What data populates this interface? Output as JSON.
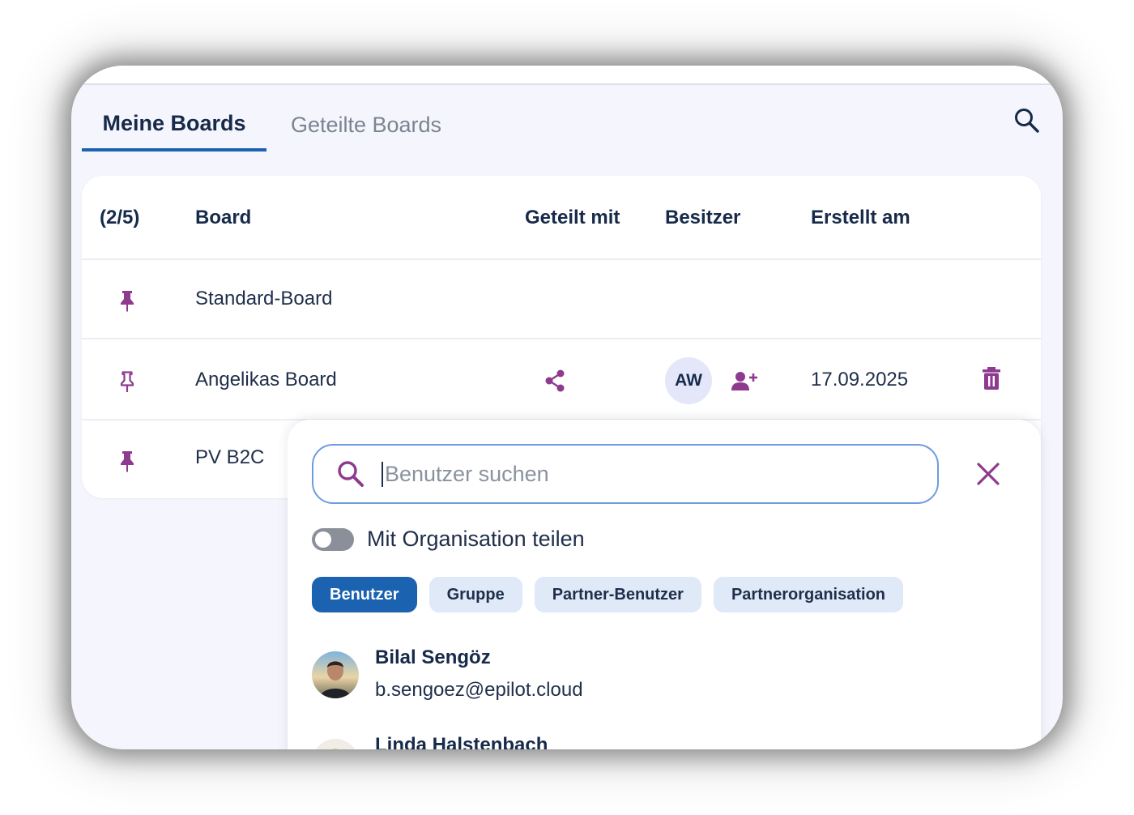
{
  "tabs": [
    {
      "label": "Meine Boards",
      "active": true
    },
    {
      "label": "Geteilte Boards",
      "active": false
    }
  ],
  "table": {
    "header": {
      "count": "(2/5)",
      "board": "Board",
      "shared_with": "Geteilt mit",
      "owner": "Besitzer",
      "created": "Erstellt am"
    },
    "rows": [
      {
        "pinned": true,
        "name": "Standard-Board"
      },
      {
        "pinned": false,
        "name": "Angelikas Board",
        "owner_initials": "AW",
        "created": "17.09.2025"
      },
      {
        "pinned": true,
        "name": "PV B2C"
      }
    ]
  },
  "share_popover": {
    "search_placeholder": "Benutzer suchen",
    "toggle_label": "Mit Organisation teilen",
    "toggle_on": false,
    "filters": [
      {
        "label": "Benutzer",
        "active": true
      },
      {
        "label": "Gruppe",
        "active": false
      },
      {
        "label": "Partner-Benutzer",
        "active": false
      },
      {
        "label": "Partnerorganisation",
        "active": false
      }
    ],
    "users": [
      {
        "name": "Bilal Sengöz",
        "email": "b.sengoez@epilot.cloud"
      },
      {
        "name": "Linda Halstenbach",
        "email": ""
      }
    ]
  },
  "colors": {
    "accent_blue": "#1b62b0",
    "icon_purple": "#8e3a8f",
    "text_dark": "#172a4a"
  }
}
